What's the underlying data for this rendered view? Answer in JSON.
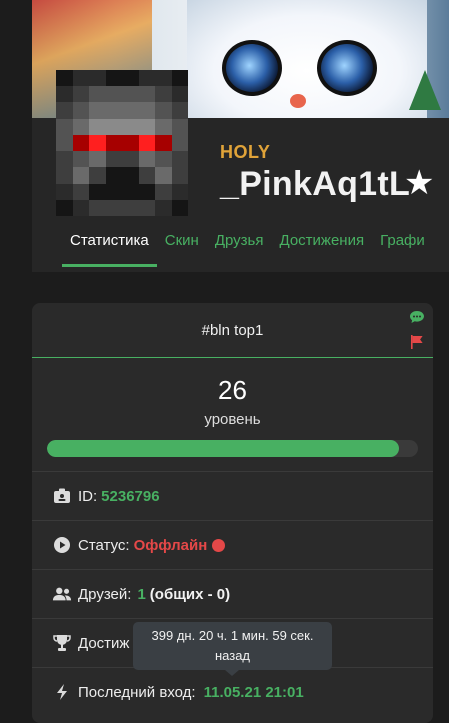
{
  "profile": {
    "rank_tag": "HOLY",
    "username": "_PinkAq1tL",
    "star_icon": "star-icon"
  },
  "tabs": [
    {
      "label": "Статистика",
      "active": true
    },
    {
      "label": "Скин"
    },
    {
      "label": "Друзья"
    },
    {
      "label": "Достижения"
    },
    {
      "label": "Графи"
    }
  ],
  "card": {
    "title": "#bln top1",
    "level": "26",
    "level_label": "уровень",
    "level_progress": 0.95,
    "id_label": "ID:",
    "id_value": "5236796",
    "status_label": "Статус:",
    "status_value": "Оффлайн",
    "friends_label": "Друзей:",
    "friends_count": "1",
    "friends_common": "(общих - 0)",
    "achievements_label": "Достиж",
    "last_login_label": "Последний вход:",
    "last_login_value": "11.05.21 21:01"
  },
  "tooltip": {
    "line1": "399 дн. 20 ч. 1 мин. 59 сек.",
    "line2": "назад"
  },
  "colors": {
    "accent": "#48b062",
    "tag": "#e0a339",
    "offline": "#e44848",
    "background": "#1c1c1c",
    "card": "#2a2a2a"
  }
}
